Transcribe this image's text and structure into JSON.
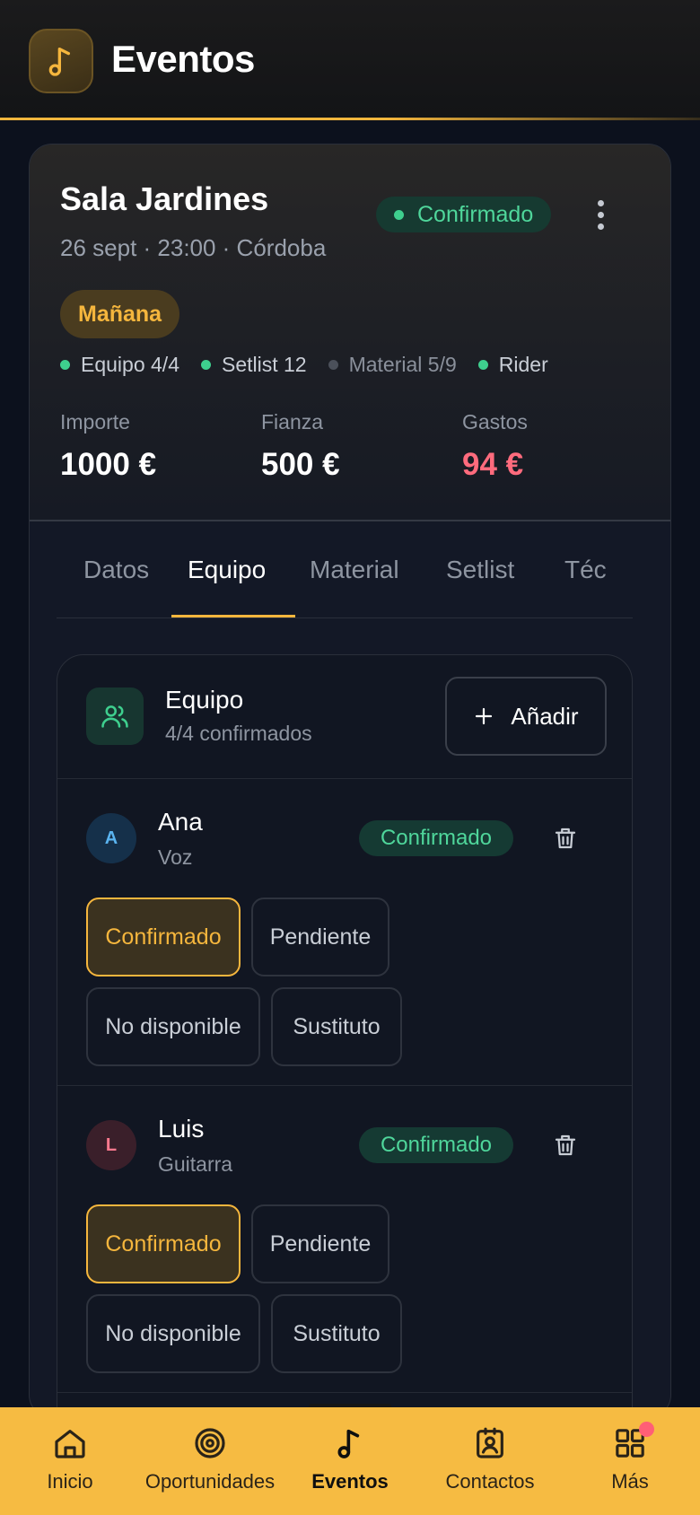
{
  "header": {
    "title": "Eventos"
  },
  "event": {
    "name": "Sala Jardines",
    "meta": "26 sept · 23:00 · Córdoba",
    "status": "Confirmado",
    "tag": "Mañana",
    "checks": [
      {
        "label": "Equipo 4/4",
        "color": "#3ecf8e",
        "muted": false
      },
      {
        "label": "Setlist 12",
        "color": "#3ecf8e",
        "muted": false
      },
      {
        "label": "Material 5/9",
        "color": "#4b505a",
        "muted": true
      },
      {
        "label": "Rider",
        "color": "#3ecf8e",
        "muted": false
      }
    ],
    "importe": {
      "label": "Importe",
      "value": "1000 €"
    },
    "fianza": {
      "label": "Fianza",
      "value": "500 €"
    },
    "gastos": {
      "label": "Gastos",
      "value": "94 €"
    }
  },
  "tabs": [
    "Datos",
    "Equipo",
    "Material",
    "Setlist",
    "Téc"
  ],
  "active_tab": "Equipo",
  "team": {
    "title": "Equipo",
    "subtitle": "4/4 confirmados",
    "add_label": "Añadir",
    "members": [
      {
        "initial": "A",
        "name": "Ana",
        "role": "Voz",
        "status": "Confirmado"
      },
      {
        "initial": "L",
        "name": "Luis",
        "role": "Guitarra",
        "status": "Confirmado"
      }
    ],
    "options": [
      "Confirmado",
      "Pendiente",
      "No disponible",
      "Sustituto"
    ]
  },
  "nav": {
    "items": [
      "Inicio",
      "Oportunidades",
      "Eventos",
      "Contactos",
      "Más"
    ],
    "active": "Eventos"
  },
  "colors": {
    "accent": "#f5b63d",
    "success": "#3ecf8e",
    "danger": "#ff6b7d",
    "background": "#0c111d"
  }
}
